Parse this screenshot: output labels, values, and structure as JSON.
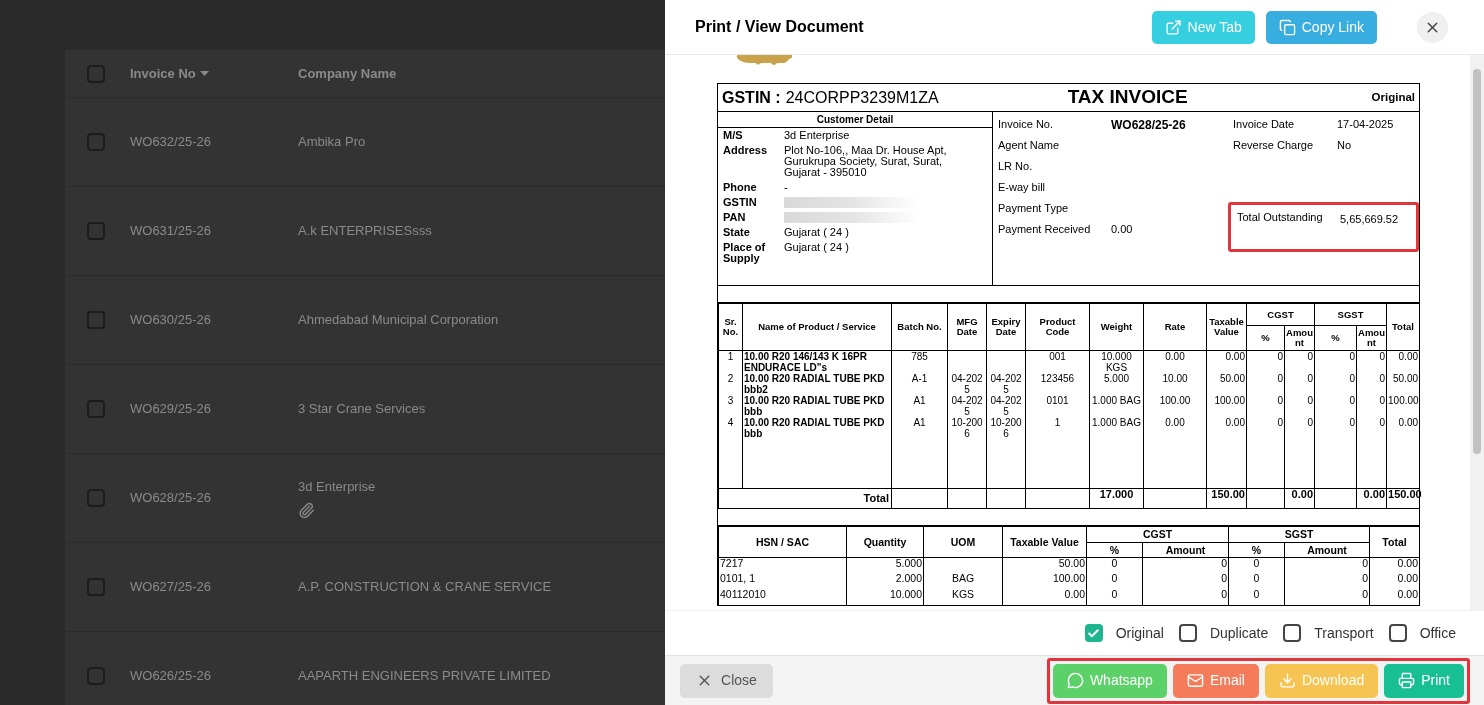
{
  "list": {
    "header": {
      "checked": false,
      "invoice_no": "Invoice No",
      "company_name": "Company Name"
    },
    "rows": [
      {
        "invoice_no": "WO632/25-26",
        "company": "Ambika Pro",
        "checked": false,
        "attachment": false
      },
      {
        "invoice_no": "WO631/25-26",
        "company": "A.k ENTERPRISESsss",
        "checked": false,
        "attachment": false
      },
      {
        "invoice_no": "WO630/25-26",
        "company": "Ahmedabad Municipal Corporation",
        "checked": false,
        "attachment": false
      },
      {
        "invoice_no": "WO629/25-26",
        "company": "3 Star Crane Services",
        "checked": false,
        "attachment": false
      },
      {
        "invoice_no": "WO628/25-26",
        "company": "3d Enterprise",
        "checked": false,
        "attachment": true
      },
      {
        "invoice_no": "WO627/25-26",
        "company": "A.P. CONSTRUCTION & CRANE SERVICE",
        "checked": false,
        "attachment": false
      },
      {
        "invoice_no": "WO626/25-26",
        "company": "AAPARTH ENGINEERS PRIVATE LIMITED",
        "checked": false,
        "attachment": false
      }
    ]
  },
  "drawer": {
    "title": "Print / View Document",
    "actions": [
      {
        "label": "New Tab",
        "kind": "new_tab"
      },
      {
        "label": "Copy Link",
        "kind": "copy_link"
      }
    ]
  },
  "document": {
    "gstin_label": "GSTIN :",
    "gstin": "24CORPP3239M1ZA",
    "title": "TAX INVOICE",
    "copy": "Original",
    "customer": {
      "heading": "Customer Detail",
      "fields": [
        {
          "label": "M/S",
          "value": "3d Enterprise"
        },
        {
          "label": "Address",
          "value": "Plot No-106,, Maa Dr. House Apt, Gurukrupa Society, Surat, Surat, Gujarat - 395010"
        },
        {
          "label": "Phone",
          "value": "-"
        },
        {
          "label": "GSTIN",
          "redacted": true
        },
        {
          "label": "PAN",
          "redacted": true
        },
        {
          "label": "State",
          "value": "Gujarat ( 24 )"
        },
        {
          "label": "Place of Supply",
          "value": "Gujarat ( 24 )"
        }
      ]
    },
    "details_left": [
      {
        "label": "Invoice No.",
        "value": "WO628/25-26",
        "bold": true
      },
      {
        "label": "Agent Name"
      },
      {
        "label": "LR No."
      },
      {
        "label": "E-way bill"
      },
      {
        "label": "Payment Type"
      },
      {
        "label": "Payment Received",
        "value": "0.00",
        "bold": false
      }
    ],
    "details_right": [
      {
        "label": "Invoice Date",
        "value": "17-04-2025",
        "highlighted": false
      },
      {
        "label": "Reverse Charge",
        "value": "No",
        "highlighted": false
      },
      {
        "label": "Total Outstanding",
        "value": "5,65,669.52",
        "highlighted": true
      }
    ],
    "items": {
      "columns": {
        "sr": "Sr. No.",
        "name": "Name of Product / Service",
        "batch": "Batch No.",
        "mfg": "MFG Date",
        "expiry": "Expiry Date",
        "code": "Product Code",
        "weight": "Weight",
        "rate": "Rate",
        "taxable": "Taxable Value",
        "cgst": "CGST",
        "sgst": "SGST",
        "cgst_pct": "%",
        "cgst_amt": "Amount",
        "sgst_pct": "%",
        "sgst_amt": "Amount",
        "total": "Total"
      },
      "rows": [
        {
          "sr": "1",
          "name": "10.00 R20 146/143 K 16PR ENDURACE LD\"s",
          "batch": "785",
          "code": "001",
          "weight": "10.000 KGS",
          "rate": "0.00",
          "taxable": "0.00",
          "cgst_pct": "0",
          "cgst_amt": "0",
          "sgst_pct": "0",
          "sgst_amt": "0",
          "total": "0.00"
        },
        {
          "sr": "2",
          "name": "10.00 R20 RADIAL TUBE PKD bbb2",
          "batch": "A-1",
          "mfg": "04-2025",
          "expiry": "04-2025",
          "code": "123456",
          "weight": "5.000",
          "rate": "10.00",
          "taxable": "50.00",
          "cgst_pct": "0",
          "cgst_amt": "0",
          "sgst_pct": "0",
          "sgst_amt": "0",
          "total": "50.00"
        },
        {
          "sr": "3",
          "name": "10.00 R20 RADIAL TUBE PKD bbb",
          "batch": "A1",
          "mfg": "04-2025",
          "expiry": "04-2025",
          "code": "0101",
          "weight": "1.000 BAG",
          "rate": "100.00",
          "taxable": "100.00",
          "cgst_pct": "0",
          "cgst_amt": "0",
          "sgst_pct": "0",
          "sgst_amt": "0",
          "total": "100.00"
        },
        {
          "sr": "4",
          "name": "10.00 R20 RADIAL TUBE PKD bbb",
          "batch": "A1",
          "mfg": "10-2006",
          "expiry": "10-2006",
          "code": "1",
          "weight": "1.000 BAG",
          "rate": "0.00",
          "taxable": "0.00",
          "cgst_pct": "0",
          "cgst_amt": "0",
          "sgst_pct": "0",
          "sgst_amt": "0",
          "total": "0.00"
        }
      ],
      "totals": {
        "label": "Total",
        "weight": "17.000",
        "taxable": "150.00",
        "cgst_amt": "0.00",
        "sgst_amt": "0.00",
        "total": "150.00"
      }
    },
    "hsn": {
      "columns": {
        "hsn": "HSN / SAC",
        "qty": "Quantity",
        "uom": "UOM",
        "taxable": "Taxable Value",
        "cgst": "CGST",
        "sgst": "SGST",
        "cgst_pct": "%",
        "cgst_amt": "Amount",
        "sgst_pct": "%",
        "sgst_amt": "Amount",
        "total": "Total"
      },
      "rows": [
        {
          "hsn": "7217",
          "qty": "5.000",
          "taxable": "50.00",
          "cgst_pct": "0",
          "cgst_amt": "0",
          "sgst_pct": "0",
          "sgst_amt": "0",
          "total": "0.00"
        },
        {
          "hsn": "0101, 1",
          "qty": "2.000",
          "uom": "BAG",
          "taxable": "100.00",
          "cgst_pct": "0",
          "cgst_amt": "0",
          "sgst_pct": "0",
          "sgst_amt": "0",
          "total": "0.00"
        },
        {
          "hsn": "40112010",
          "qty": "10.000",
          "uom": "KGS",
          "taxable": "0.00",
          "cgst_pct": "0",
          "cgst_amt": "0",
          "sgst_pct": "0",
          "sgst_amt": "0",
          "total": "0.00"
        }
      ]
    }
  },
  "copies": [
    {
      "label": "Original",
      "checked": true
    },
    {
      "label": "Duplicate",
      "checked": false
    },
    {
      "label": "Transport",
      "checked": false
    },
    {
      "label": "Office",
      "checked": false
    }
  ],
  "footer": {
    "close": "Close",
    "actions": [
      {
        "label": "Whatsapp",
        "kind": "whatsapp"
      },
      {
        "label": "Email",
        "kind": "email"
      },
      {
        "label": "Download",
        "kind": "download"
      },
      {
        "label": "Print",
        "kind": "print"
      }
    ]
  }
}
